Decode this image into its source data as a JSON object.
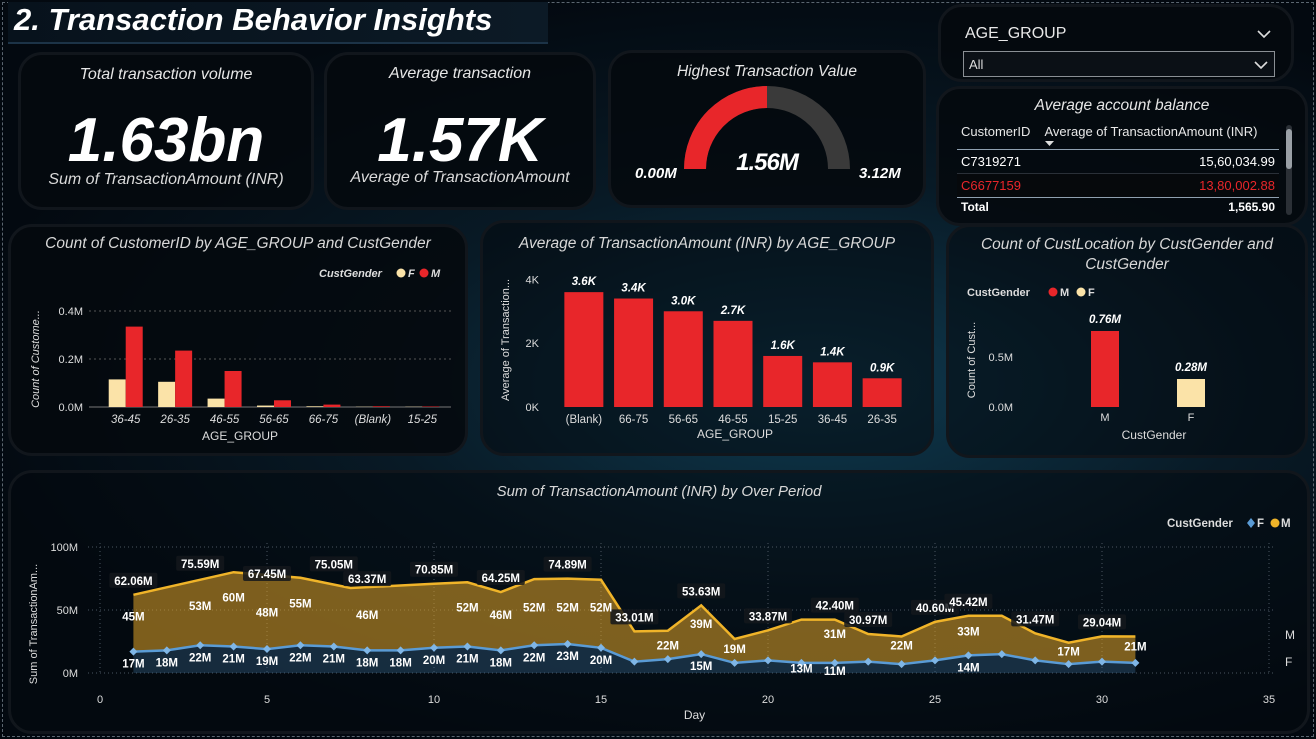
{
  "page_title": "2. Transaction Behavior Insights",
  "kpis": {
    "volume": {
      "title": "Total transaction volume",
      "value": "1.63bn",
      "subtitle": "Sum of TransactionAmount (INR)"
    },
    "average": {
      "title": "Average transaction",
      "value": "1.57K",
      "subtitle": "Average of TransactionAmount"
    }
  },
  "gauge": {
    "title": "Highest Transaction Value",
    "value_label": "1.56M",
    "min_label": "0.00M",
    "max_label": "3.12M",
    "fill_fraction": 0.5,
    "fill_color": "#e8262a",
    "track_color": "#3a3a3a"
  },
  "slicer": {
    "label": "AGE_GROUP",
    "selected": "All"
  },
  "balance_table": {
    "title": "Average account balance",
    "headers": [
      "CustomerID",
      "Average of TransactionAmount (INR)"
    ],
    "rows": [
      {
        "id": "C7319271",
        "value": "15,60,034.99",
        "highlight": false
      },
      {
        "id": "C6677159",
        "value": "13,80,002.88",
        "highlight": true
      }
    ],
    "total_label": "Total",
    "total_value": "1,565.90"
  },
  "chart_data": [
    {
      "type": "bar",
      "title": "Count of CustomerID by AGE_GROUP and CustGender",
      "xlabel": "AGE_GROUP",
      "ylabel": "Count of Custome...",
      "legend_title": "CustGender",
      "legend_position": "top-right",
      "categories": [
        "36-45",
        "26-35",
        "46-55",
        "56-65",
        "66-75",
        "(Blank)",
        "15-25"
      ],
      "series": [
        {
          "name": "F",
          "color": "#fbe3a8",
          "values": [
            0.115,
            0.105,
            0.035,
            0.006,
            0.003,
            0.001,
            0.001
          ]
        },
        {
          "name": "M",
          "color": "#e8262a",
          "values": [
            0.335,
            0.235,
            0.15,
            0.028,
            0.01,
            0.003,
            0.002
          ]
        }
      ],
      "ylim": [
        0,
        0.45
      ],
      "yticks": [
        "0.0M",
        "0.2M",
        "0.4M"
      ],
      "ytick_values": [
        0,
        0.2,
        0.4
      ],
      "grid": true
    },
    {
      "type": "bar",
      "title": "Average of TransactionAmount (INR) by AGE_GROUP",
      "xlabel": "AGE_GROUP",
      "ylabel": "Average of Transaction...",
      "categories": [
        "(Blank)",
        "66-75",
        "56-65",
        "46-55",
        "15-25",
        "36-45",
        "26-35"
      ],
      "values": [
        3.6,
        3.4,
        3.0,
        2.7,
        1.6,
        1.4,
        0.9
      ],
      "data_labels": [
        "3.6K",
        "3.4K",
        "3.0K",
        "2.7K",
        "1.6K",
        "1.4K",
        "0.9K"
      ],
      "color": "#e8262a",
      "ylim": [
        0,
        4.2
      ],
      "yticks": [
        "0K",
        "2K",
        "4K"
      ],
      "ytick_values": [
        0,
        2,
        4
      ]
    },
    {
      "type": "bar",
      "title": "Count of CustLocation by CustGender and CustGender",
      "xlabel": "CustGender",
      "ylabel": "Count of Cust...",
      "legend_title": "CustGender",
      "legend_position": "top-left",
      "legend": [
        {
          "name": "M",
          "color": "#e8262a"
        },
        {
          "name": "F",
          "color": "#fbe3a8"
        }
      ],
      "categories": [
        "M",
        "F"
      ],
      "values": [
        0.76,
        0.28
      ],
      "data_labels": [
        "0.76M",
        "0.28M"
      ],
      "colors": [
        "#e8262a",
        "#fbe3a8"
      ],
      "ylim": [
        0,
        0.9
      ],
      "yticks": [
        "0.0M",
        "0.5M"
      ],
      "ytick_values": [
        0,
        0.5
      ]
    },
    {
      "type": "area",
      "title": "Sum of TransactionAmount (INR) by Over Period",
      "xlabel": "Day",
      "ylabel": "Sum of TransactionAm...",
      "legend_title": "CustGender",
      "legend_position": "top-right",
      "legend": [
        {
          "name": "F",
          "color": "#5a9bd5"
        },
        {
          "name": "M",
          "color": "#f0b429"
        }
      ],
      "end_labels": [
        "M",
        "F"
      ],
      "xlim": [
        0,
        35
      ],
      "xticks": [
        0,
        5,
        10,
        15,
        20,
        25,
        30,
        35
      ],
      "ylim": [
        0,
        100
      ],
      "yticks": [
        "0M",
        "50M",
        "100M"
      ],
      "ytick_values": [
        0,
        50,
        100
      ],
      "total": {
        "x": [
          1,
          4,
          6,
          7.5,
          10,
          11,
          12,
          13,
          14,
          15,
          16,
          17,
          18,
          19,
          20,
          21,
          22,
          23,
          24,
          25,
          26,
          27,
          28,
          29,
          30,
          31
        ],
        "y": [
          62.06,
          80,
          75.59,
          67.45,
          70.85,
          72,
          64.25,
          74.5,
          74.89,
          74,
          33.01,
          33.5,
          53.63,
          27,
          33.87,
          42.4,
          42.4,
          30.97,
          29,
          40.6,
          45.42,
          45.42,
          31.47,
          24,
          29.04,
          29
        ],
        "labels": [
          {
            "x": 1,
            "y": 62.06,
            "text": "62.06M"
          },
          {
            "x": 3,
            "y": 75.59,
            "text": "75.59M"
          },
          {
            "x": 5,
            "y": 67.45,
            "text": "67.45M"
          },
          {
            "x": 7,
            "y": 75.05,
            "text": "75.05M"
          },
          {
            "x": 8,
            "y": 63.37,
            "text": "63.37M"
          },
          {
            "x": 10,
            "y": 70.85,
            "text": "70.85M"
          },
          {
            "x": 12,
            "y": 64.25,
            "text": "64.25M"
          },
          {
            "x": 14,
            "y": 74.89,
            "text": "74.89M"
          },
          {
            "x": 16,
            "y": 33.01,
            "text": "33.01M"
          },
          {
            "x": 18,
            "y": 53.63,
            "text": "53.63M"
          },
          {
            "x": 20,
            "y": 33.87,
            "text": "33.87M"
          },
          {
            "x": 22,
            "y": 42.4,
            "text": "42.40M"
          },
          {
            "x": 23,
            "y": 30.97,
            "text": "30.97M"
          },
          {
            "x": 25,
            "y": 40.6,
            "text": "40.60M"
          },
          {
            "x": 26,
            "y": 45.42,
            "text": "45.42M"
          },
          {
            "x": 28,
            "y": 31.47,
            "text": "31.47M"
          },
          {
            "x": 30,
            "y": 29.04,
            "text": "29.04M"
          }
        ]
      },
      "m_labels": [
        {
          "x": 1,
          "y": 45,
          "text": "45M"
        },
        {
          "x": 3,
          "y": 53,
          "text": "53M"
        },
        {
          "x": 4,
          "y": 60,
          "text": "60M"
        },
        {
          "x": 5,
          "y": 48,
          "text": "48M"
        },
        {
          "x": 6,
          "y": 55,
          "text": "55M"
        },
        {
          "x": 8,
          "y": 46,
          "text": "46M"
        },
        {
          "x": 11,
          "y": 52,
          "text": "52M"
        },
        {
          "x": 12,
          "y": 46,
          "text": "46M"
        },
        {
          "x": 13,
          "y": 52,
          "text": "52M"
        },
        {
          "x": 14,
          "y": 52,
          "text": "52M"
        },
        {
          "x": 15,
          "y": 52,
          "text": "52M"
        },
        {
          "x": 17,
          "y": 22,
          "text": "22M"
        },
        {
          "x": 18,
          "y": 39,
          "text": "39M"
        },
        {
          "x": 19,
          "y": 19,
          "text": "19M"
        },
        {
          "x": 22,
          "y": 31,
          "text": "31M"
        },
        {
          "x": 24,
          "y": 22,
          "text": "22M"
        },
        {
          "x": 26,
          "y": 33,
          "text": "33M"
        },
        {
          "x": 29,
          "y": 17,
          "text": "17M"
        },
        {
          "x": 31,
          "y": 21,
          "text": "21M"
        }
      ],
      "f_series": {
        "x": [
          1,
          2,
          3,
          4,
          5,
          6,
          7,
          8,
          9,
          10,
          11,
          12,
          13,
          14,
          15,
          16,
          17,
          18,
          19,
          20,
          21,
          22,
          23,
          24,
          25,
          26,
          27,
          28,
          29,
          30,
          31
        ],
        "y": [
          17,
          18,
          22,
          21,
          19,
          22,
          21,
          18,
          18,
          20,
          21,
          18,
          22,
          23,
          20,
          9,
          11,
          15,
          8,
          10,
          8,
          8,
          9,
          7,
          10,
          14,
          15,
          10,
          7,
          9,
          8
        ],
        "labels": [
          {
            "x": 1,
            "y": 17,
            "text": "17M"
          },
          {
            "x": 2,
            "y": 18,
            "text": "18M"
          },
          {
            "x": 3,
            "y": 22,
            "text": "22M"
          },
          {
            "x": 4,
            "y": 21,
            "text": "21M"
          },
          {
            "x": 5,
            "y": 19,
            "text": "19M"
          },
          {
            "x": 6,
            "y": 22,
            "text": "22M"
          },
          {
            "x": 7,
            "y": 21,
            "text": "21M"
          },
          {
            "x": 8,
            "y": 18,
            "text": "18M"
          },
          {
            "x": 9,
            "y": 18,
            "text": "18M"
          },
          {
            "x": 10,
            "y": 20,
            "text": "20M"
          },
          {
            "x": 11,
            "y": 21,
            "text": "21M"
          },
          {
            "x": 12,
            "y": 18,
            "text": "18M"
          },
          {
            "x": 13,
            "y": 22,
            "text": "22M"
          },
          {
            "x": 14,
            "y": 23,
            "text": "23M"
          },
          {
            "x": 15,
            "y": 20,
            "text": "20M"
          },
          {
            "x": 18,
            "y": 15,
            "text": "15M"
          },
          {
            "x": 21,
            "y": 13,
            "text": "13M"
          },
          {
            "x": 22,
            "y": 11,
            "text": "11M"
          },
          {
            "x": 26,
            "y": 14,
            "text": "14M"
          }
        ]
      }
    }
  ]
}
